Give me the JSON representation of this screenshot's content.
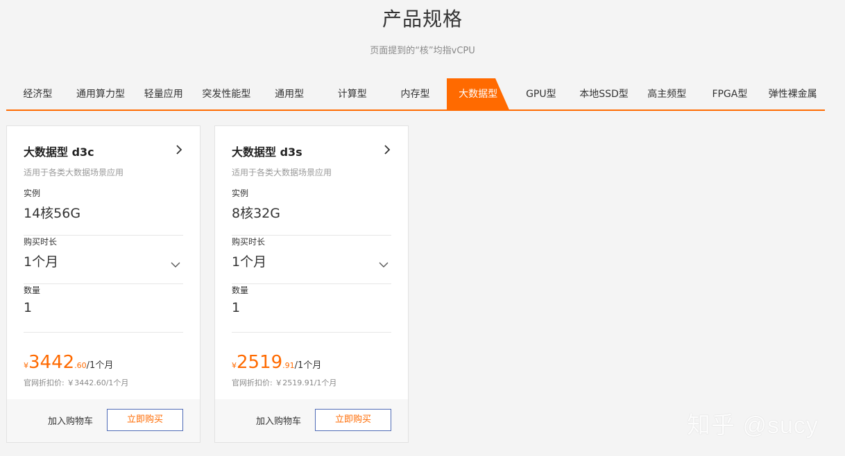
{
  "header": {
    "title": "产品规格",
    "subtitle": "页面提到的“核”均指vCPU"
  },
  "tabs": [
    {
      "label": "经济型",
      "active": false
    },
    {
      "label": "通用算力型",
      "active": false
    },
    {
      "label": "轻量应用",
      "active": false
    },
    {
      "label": "突发性能型",
      "active": false
    },
    {
      "label": "通用型",
      "active": false
    },
    {
      "label": "计算型",
      "active": false
    },
    {
      "label": "内存型",
      "active": false
    },
    {
      "label": "大数据型",
      "active": true
    },
    {
      "label": "GPU型",
      "active": false
    },
    {
      "label": "本地SSD型",
      "active": false
    },
    {
      "label": "高主频型",
      "active": false
    },
    {
      "label": "FPGA型",
      "active": false
    },
    {
      "label": "弹性裸金属",
      "active": false
    }
  ],
  "cards": [
    {
      "title": "大数据型 d3c",
      "desc": "适用于各类大数据场景应用",
      "instance_label": "实例",
      "instance_value": "14核56G",
      "duration_label": "购买时长",
      "duration_value": "1个月",
      "quantity_label": "数量",
      "quantity_value": "1",
      "price_currency": "¥",
      "price_int": "3442",
      "price_dec": ".60",
      "price_per": "/1个月",
      "price_note": "官网折扣价: ￥3442.60/1个月",
      "cart_label": "加入购物车",
      "buy_label": "立即购买"
    },
    {
      "title": "大数据型 d3s",
      "desc": "适用于各类大数据场景应用",
      "instance_label": "实例",
      "instance_value": "8核32G",
      "duration_label": "购买时长",
      "duration_value": "1个月",
      "quantity_label": "数量",
      "quantity_value": "1",
      "price_currency": "¥",
      "price_int": "2519",
      "price_dec": ".91",
      "price_per": "/1个月",
      "price_note": "官网折扣价: ￥2519.91/1个月",
      "cart_label": "加入购物车",
      "buy_label": "立即购买"
    }
  ],
  "icons": {
    "card_link": "chevron-right-icon",
    "duration_select": "chevron-down-icon"
  },
  "colors": {
    "accent": "#ff6a00",
    "buy_border": "#4f6bb6",
    "background": "#f4f4f4"
  },
  "watermark": "知乎 @sucy"
}
